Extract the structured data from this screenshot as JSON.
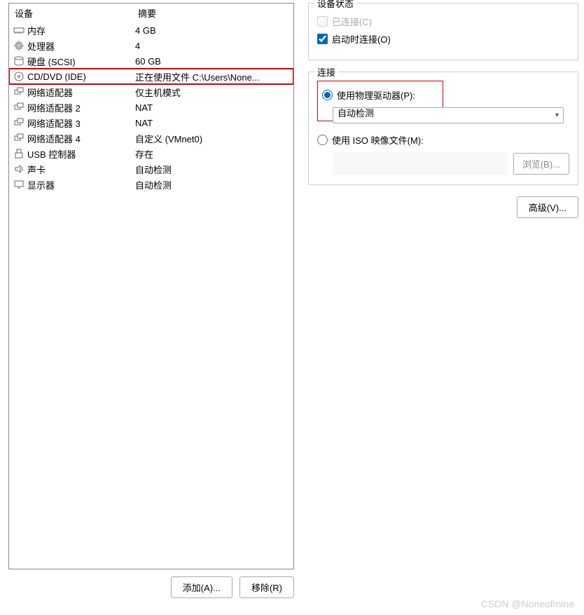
{
  "headers": {
    "device": "设备",
    "summary": "摘要"
  },
  "devices": [
    {
      "icon": "memory",
      "name": "内存",
      "summary": "4 GB"
    },
    {
      "icon": "cpu",
      "name": "处理器",
      "summary": "4"
    },
    {
      "icon": "disk",
      "name": "硬盘 (SCSI)",
      "summary": "60 GB"
    },
    {
      "icon": "cd",
      "name": "CD/DVD (IDE)",
      "summary": "正在使用文件 C:\\Users\\None...",
      "selected": true
    },
    {
      "icon": "net",
      "name": "网络适配器",
      "summary": "仅主机模式"
    },
    {
      "icon": "net",
      "name": "网络适配器 2",
      "summary": "NAT"
    },
    {
      "icon": "net",
      "name": "网络适配器 3",
      "summary": "NAT"
    },
    {
      "icon": "net",
      "name": "网络适配器 4",
      "summary": "自定义 (VMnet0)"
    },
    {
      "icon": "usb",
      "name": "USB 控制器",
      "summary": "存在"
    },
    {
      "icon": "sound",
      "name": "声卡",
      "summary": "自动检测"
    },
    {
      "icon": "display",
      "name": "显示器",
      "summary": "自动检测"
    }
  ],
  "buttons": {
    "add": "添加(A)...",
    "remove": "移除(R)",
    "browse": "浏览(B)...",
    "advanced": "高级(V)..."
  },
  "status_group": {
    "title": "设备状态",
    "connected": {
      "label": "已连接(C)",
      "checked": false,
      "disabled": true
    },
    "connect_on_poweron": {
      "label": "启动时连接(O)",
      "checked": true
    }
  },
  "connection_group": {
    "title": "连接",
    "use_physical": {
      "label": "使用物理驱动器(P):",
      "checked": true
    },
    "physical_dropdown": "自动检测",
    "use_iso": {
      "label": "使用 ISO 映像文件(M):",
      "checked": false
    }
  },
  "watermark": "CSDN @Noneofmine"
}
